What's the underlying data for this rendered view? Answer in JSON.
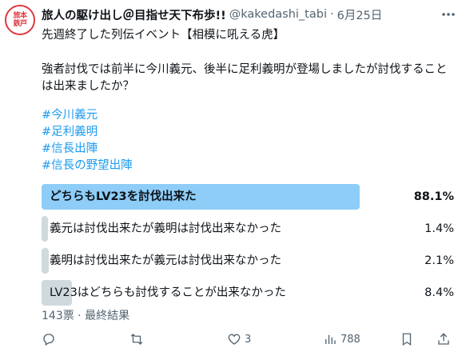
{
  "post": {
    "avatar_text": [
      "旅本",
      "鉄戸"
    ],
    "display_name": "旅人の駆け出し＠目指せ天下布歩!!",
    "handle": "@kakedashi_tabi",
    "separator": "·",
    "date": "6月25日",
    "more_icon": "more-horizontal-icon",
    "line1": "先週終了した列伝イベント【相模に吼える虎】",
    "para2": "強者討伐では前半に今川義元、後半に足利義明が登場しましたが討伐することは出来ましたか？",
    "hashtags": [
      "#今川義元",
      "#足利義明",
      "#信長出陣",
      "#信長の野望出陣"
    ]
  },
  "poll": {
    "options": [
      {
        "label": "どちらもLV23を討伐出来た",
        "percent_text": "88.1%",
        "percent": 88.1,
        "winner": true
      },
      {
        "label": "義元は討伐出来たが義明は討伐出来なかった",
        "percent_text": "1.4%",
        "percent": 1.4,
        "winner": false
      },
      {
        "label": "義明は討伐出来たが義元は討伐出来なかった",
        "percent_text": "2.1%",
        "percent": 2.1,
        "winner": false
      },
      {
        "label": "LV23はどちらも討伐することが出来なかった",
        "percent_text": "8.4%",
        "percent": 8.4,
        "winner": false
      }
    ],
    "meta": "143票 · 最終結果"
  },
  "actions": {
    "reply": {
      "icon": "reply-icon",
      "count": ""
    },
    "retweet": {
      "icon": "retweet-icon",
      "count": ""
    },
    "like": {
      "icon": "heart-icon",
      "count": "3"
    },
    "views": {
      "icon": "views-chart-icon",
      "count": "788"
    },
    "bookmark": {
      "icon": "bookmark-icon"
    },
    "share": {
      "icon": "share-icon"
    }
  },
  "colors": {
    "link": "#1d9bf0",
    "winner_bar": "#8ecdf8",
    "other_bar": "#cfd9de",
    "muted": "#536471",
    "avatar_red": "#e0393e"
  }
}
